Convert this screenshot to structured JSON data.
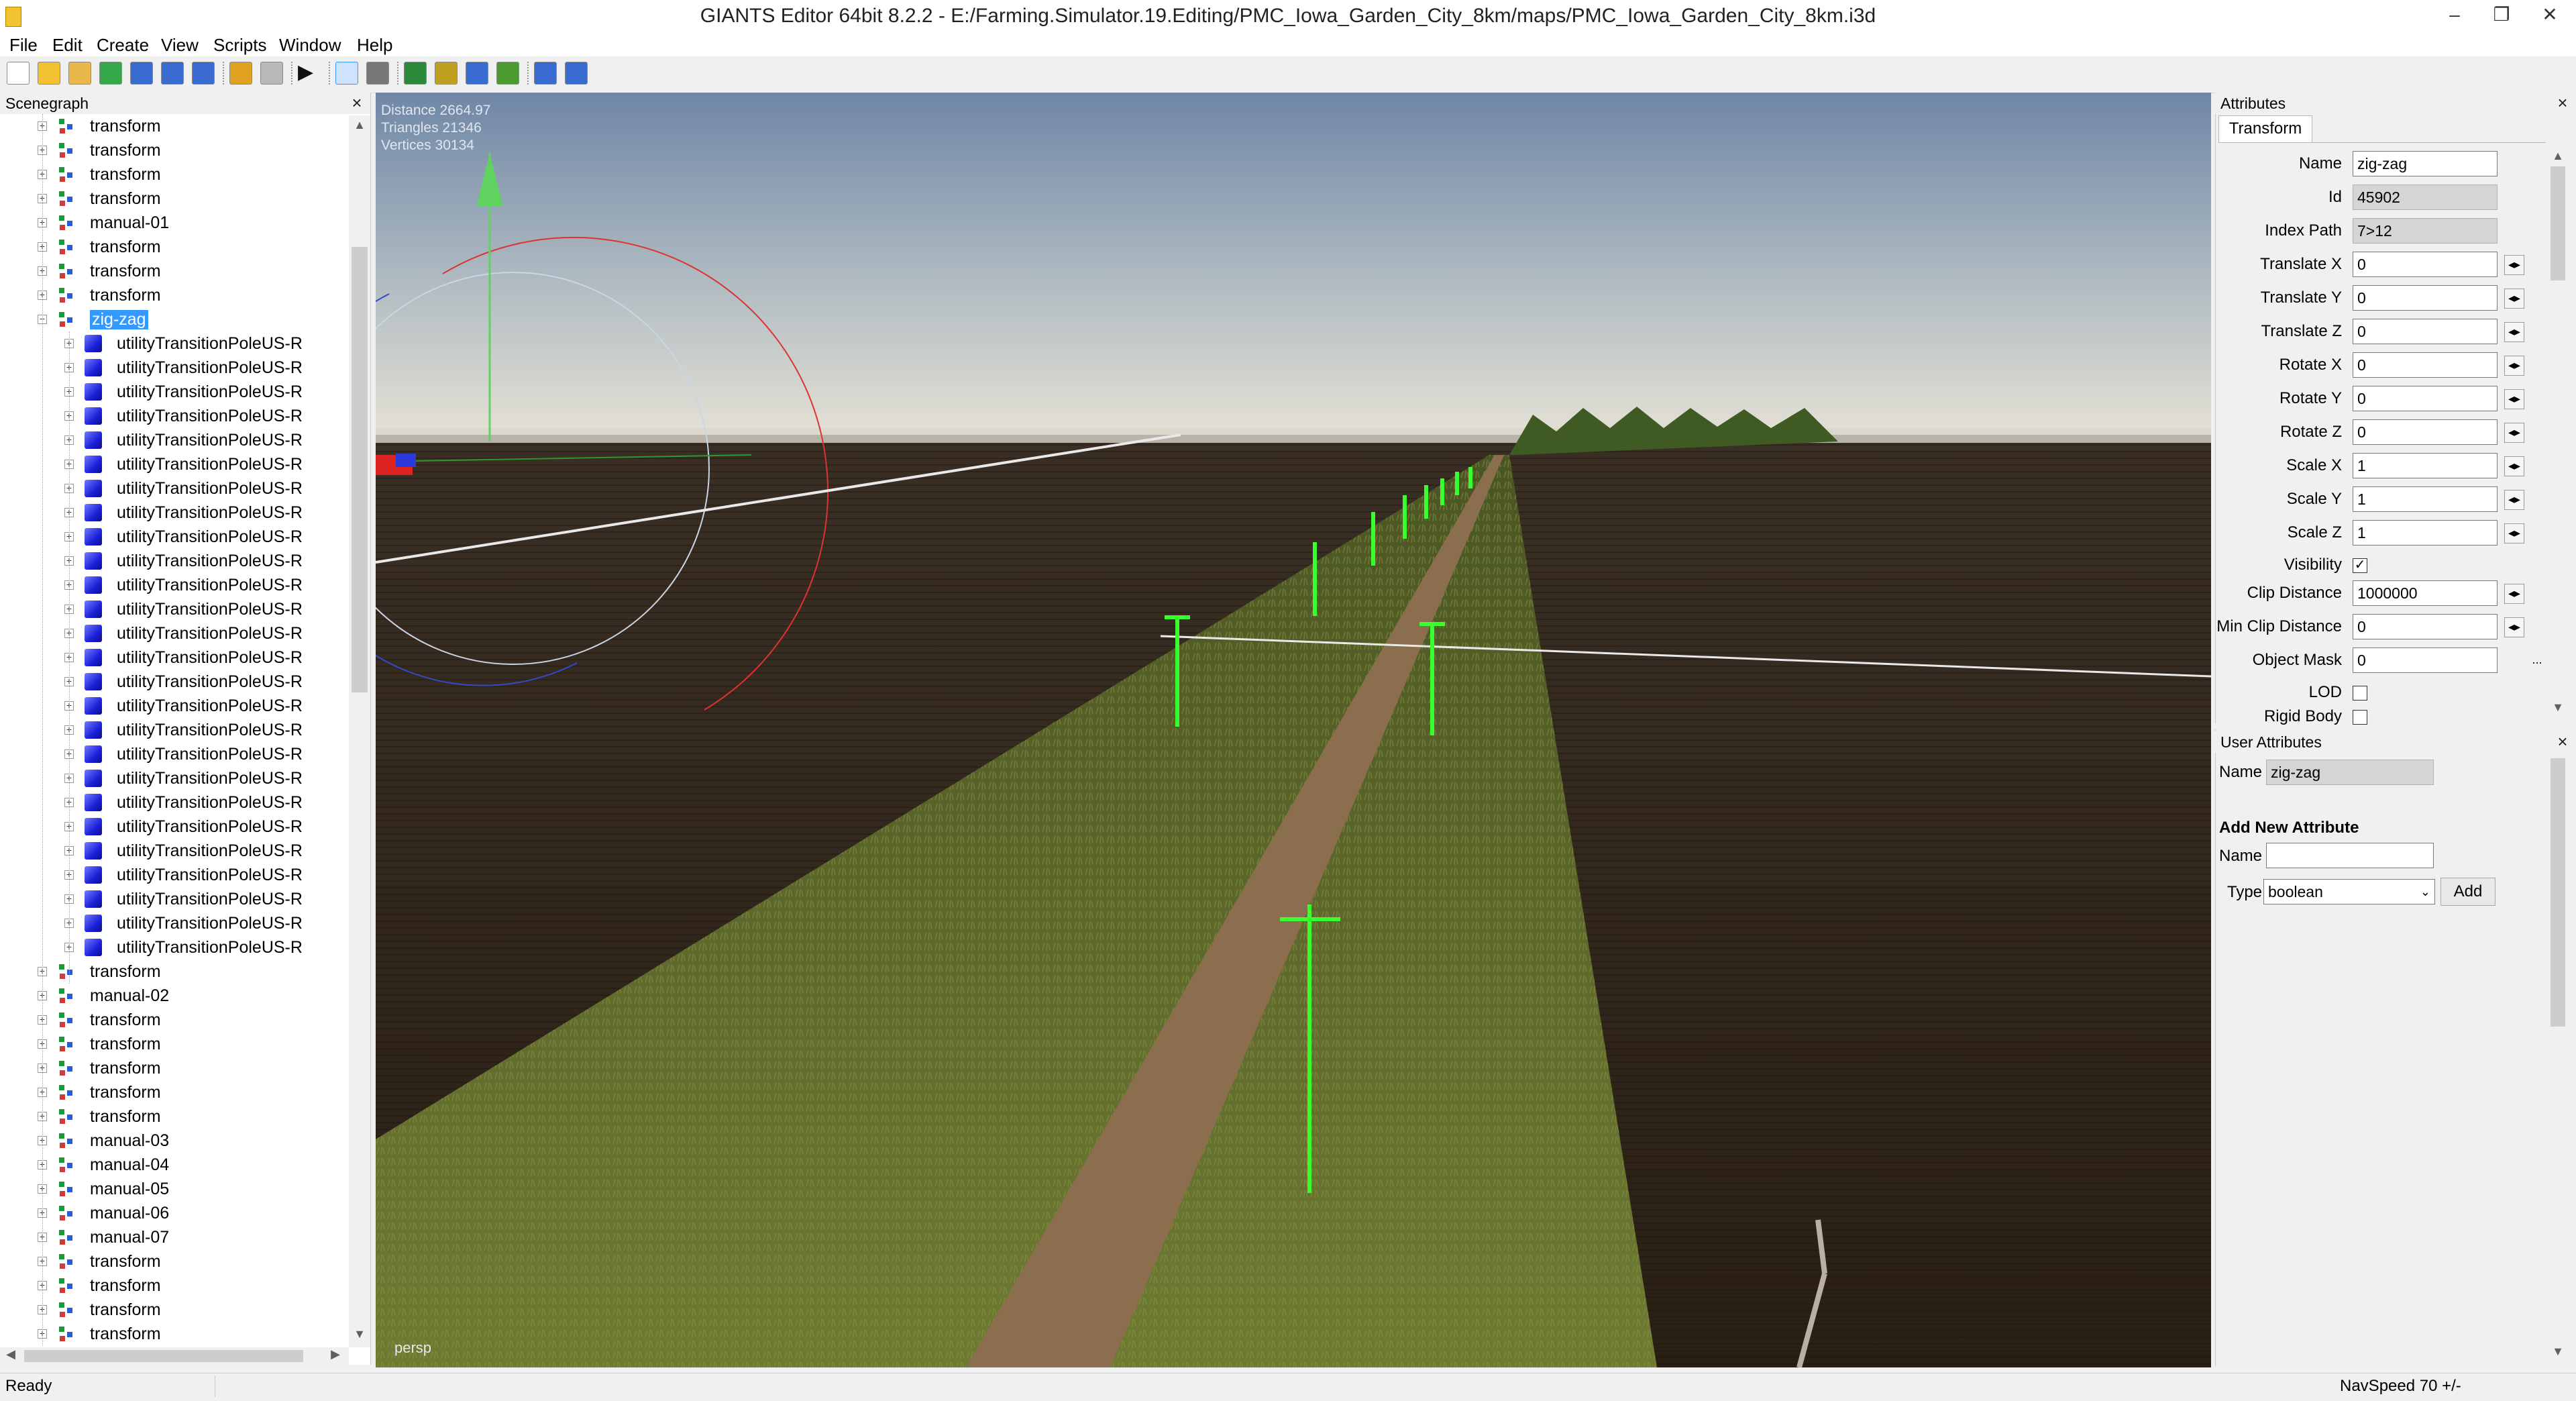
{
  "window": {
    "title": "GIANTS Editor 64bit 8.2.2 - E:/Farming.Simulator.19.Editing/PMC_Iowa_Garden_City_8km/maps/PMC_Iowa_Garden_City_8km.i3d",
    "minimize": "–",
    "maximize": "❐",
    "close": "✕"
  },
  "menu": [
    "File",
    "Edit",
    "Create",
    "View",
    "Scripts",
    "Window",
    "Help"
  ],
  "toolbar": {
    "icons": [
      "new-file-icon",
      "open-folder-icon",
      "edit-icon",
      "refresh-icon",
      "save-icon",
      "save-as-icon",
      "export-icon",
      "undo-icon",
      "redo-icon",
      "play-icon",
      "select-tool-icon",
      "magnet-icon",
      "terrain-paint-icon",
      "terrain-foliage-icon",
      "terrain-sculpt-icon",
      "terrain-height-icon",
      "settings-gear-icon",
      "gear-alt-icon"
    ]
  },
  "scenegraph": {
    "title": "Scenegraph",
    "close": "×",
    "rows": [
      {
        "label": "transform",
        "type": "transform",
        "depth": 0
      },
      {
        "label": "transform",
        "type": "transform",
        "depth": 0
      },
      {
        "label": "transform",
        "type": "transform",
        "depth": 0
      },
      {
        "label": "transform",
        "type": "transform",
        "depth": 0
      },
      {
        "label": "manual-01",
        "type": "transform",
        "depth": 0
      },
      {
        "label": "transform",
        "type": "transform",
        "depth": 0
      },
      {
        "label": "transform",
        "type": "transform",
        "depth": 0
      },
      {
        "label": "transform",
        "type": "transform",
        "depth": 0
      },
      {
        "label": "zig-zag",
        "type": "transform",
        "depth": 0,
        "expanded": true,
        "selected": true
      },
      {
        "label": "utilityTransitionPoleUS-R",
        "type": "shape",
        "depth": 1
      },
      {
        "label": "utilityTransitionPoleUS-R",
        "type": "shape",
        "depth": 1
      },
      {
        "label": "utilityTransitionPoleUS-R",
        "type": "shape",
        "depth": 1
      },
      {
        "label": "utilityTransitionPoleUS-R",
        "type": "shape",
        "depth": 1
      },
      {
        "label": "utilityTransitionPoleUS-R",
        "type": "shape",
        "depth": 1
      },
      {
        "label": "utilityTransitionPoleUS-R",
        "type": "shape",
        "depth": 1
      },
      {
        "label": "utilityTransitionPoleUS-R",
        "type": "shape",
        "depth": 1
      },
      {
        "label": "utilityTransitionPoleUS-R",
        "type": "shape",
        "depth": 1
      },
      {
        "label": "utilityTransitionPoleUS-R",
        "type": "shape",
        "depth": 1
      },
      {
        "label": "utilityTransitionPoleUS-R",
        "type": "shape",
        "depth": 1
      },
      {
        "label": "utilityTransitionPoleUS-R",
        "type": "shape",
        "depth": 1
      },
      {
        "label": "utilityTransitionPoleUS-R",
        "type": "shape",
        "depth": 1
      },
      {
        "label": "utilityTransitionPoleUS-R",
        "type": "shape",
        "depth": 1
      },
      {
        "label": "utilityTransitionPoleUS-R",
        "type": "shape",
        "depth": 1
      },
      {
        "label": "utilityTransitionPoleUS-R",
        "type": "shape",
        "depth": 1
      },
      {
        "label": "utilityTransitionPoleUS-R",
        "type": "shape",
        "depth": 1
      },
      {
        "label": "utilityTransitionPoleUS-R",
        "type": "shape",
        "depth": 1
      },
      {
        "label": "utilityTransitionPoleUS-R",
        "type": "shape",
        "depth": 1
      },
      {
        "label": "utilityTransitionPoleUS-R",
        "type": "shape",
        "depth": 1
      },
      {
        "label": "utilityTransitionPoleUS-R",
        "type": "shape",
        "depth": 1
      },
      {
        "label": "utilityTransitionPoleUS-R",
        "type": "shape",
        "depth": 1
      },
      {
        "label": "utilityTransitionPoleUS-R",
        "type": "shape",
        "depth": 1
      },
      {
        "label": "utilityTransitionPoleUS-R",
        "type": "shape",
        "depth": 1
      },
      {
        "label": "utilityTransitionPoleUS-R",
        "type": "shape",
        "depth": 1
      },
      {
        "label": "utilityTransitionPoleUS-R",
        "type": "shape",
        "depth": 1
      },
      {
        "label": "utilityTransitionPoleUS-R",
        "type": "shape",
        "depth": 1
      },
      {
        "label": "transform",
        "type": "transform",
        "depth": 0
      },
      {
        "label": "manual-02",
        "type": "transform",
        "depth": 0
      },
      {
        "label": "transform",
        "type": "transform",
        "depth": 0
      },
      {
        "label": "transform",
        "type": "transform",
        "depth": 0
      },
      {
        "label": "transform",
        "type": "transform",
        "depth": 0
      },
      {
        "label": "transform",
        "type": "transform",
        "depth": 0
      },
      {
        "label": "transform",
        "type": "transform",
        "depth": 0
      },
      {
        "label": "manual-03",
        "type": "transform",
        "depth": 0
      },
      {
        "label": "manual-04",
        "type": "transform",
        "depth": 0
      },
      {
        "label": "manual-05",
        "type": "transform",
        "depth": 0
      },
      {
        "label": "manual-06",
        "type": "transform",
        "depth": 0
      },
      {
        "label": "manual-07",
        "type": "transform",
        "depth": 0
      },
      {
        "label": "transform",
        "type": "transform",
        "depth": 0
      },
      {
        "label": "transform",
        "type": "transform",
        "depth": 0
      },
      {
        "label": "transform",
        "type": "transform",
        "depth": 0
      },
      {
        "label": "transform",
        "type": "transform",
        "depth": 0
      }
    ]
  },
  "viewport": {
    "hud": {
      "distance": "Distance 2664.97",
      "triangles": "Triangles 21346",
      "vertices": "Vertices 30134"
    },
    "camera": "persp",
    "colors": {
      "sky_top": "#6f87a6",
      "sky_horizon": "#e6e2d6",
      "soil": "#2e241a",
      "crop": "#5f6b2a",
      "road": "#8a6e4e",
      "pole": "#39ff2e"
    }
  },
  "attributes": {
    "title": "Attributes",
    "close": "×",
    "tab": "Transform",
    "fields": [
      {
        "label": "Name",
        "value": "zig-zag",
        "kind": "text"
      },
      {
        "label": "Id",
        "value": "45902",
        "kind": "readonly"
      },
      {
        "label": "Index Path",
        "value": "7>12",
        "kind": "readonly"
      },
      {
        "label": "Translate X",
        "value": "0",
        "kind": "spin"
      },
      {
        "label": "Translate Y",
        "value": "0",
        "kind": "spin"
      },
      {
        "label": "Translate Z",
        "value": "0",
        "kind": "spin"
      },
      {
        "label": "Rotate X",
        "value": "0",
        "kind": "spin"
      },
      {
        "label": "Rotate Y",
        "value": "0",
        "kind": "spin"
      },
      {
        "label": "Rotate Z",
        "value": "0",
        "kind": "spin"
      },
      {
        "label": "Scale X",
        "value": "1",
        "kind": "spin"
      },
      {
        "label": "Scale Y",
        "value": "1",
        "kind": "spin"
      },
      {
        "label": "Scale Z",
        "value": "1",
        "kind": "spin"
      },
      {
        "label": "Visibility",
        "value": "✓",
        "kind": "check"
      },
      {
        "label": "Clip Distance",
        "value": "1000000",
        "kind": "spin"
      },
      {
        "label": "Min Clip Distance",
        "value": "0",
        "kind": "spin"
      },
      {
        "label": "Object Mask",
        "value": "0",
        "kind": "dots"
      },
      {
        "label": "LOD",
        "value": "",
        "kind": "check"
      },
      {
        "label": "Rigid Body",
        "value": "",
        "kind": "check"
      }
    ],
    "spin_glyph": "◂▸",
    "dots": "..."
  },
  "user_attributes": {
    "title": "User Attributes",
    "close": "×",
    "name_label": "Name",
    "name_value": "zig-zag",
    "add_heading": "Add New Attribute",
    "new_name_label": "Name",
    "new_name_value": "",
    "type_label": "Type",
    "type_value": "boolean",
    "add_button": "Add"
  },
  "status": {
    "text": "Ready",
    "navspeed": "NavSpeed 70 +/-"
  }
}
